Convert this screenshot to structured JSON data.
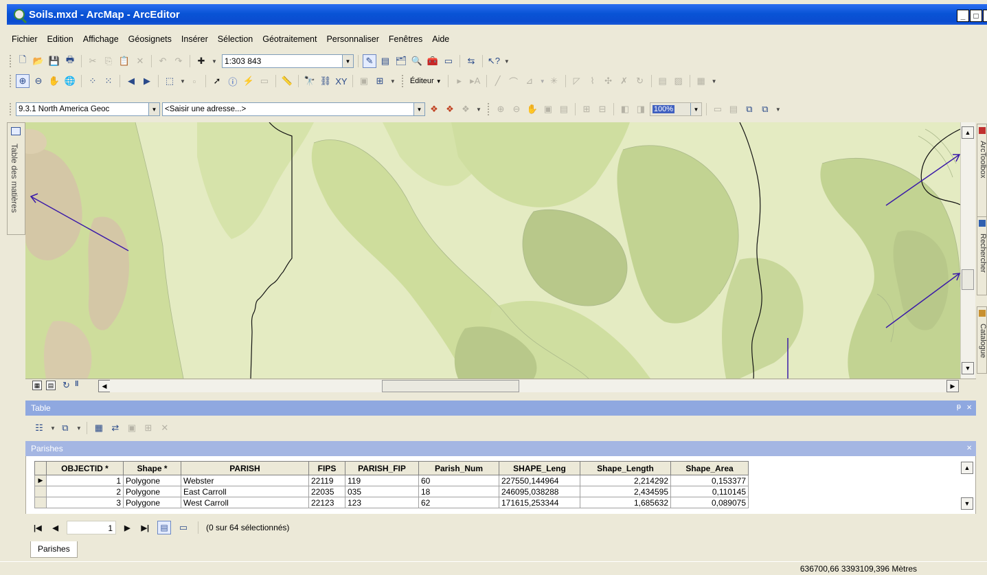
{
  "window": {
    "title": "Soils.mxd - ArcMap - ArcEditor",
    "min_label": "_",
    "max_label": "□",
    "close_label": "×"
  },
  "menu": [
    "Fichier",
    "Edition",
    "Affichage",
    "Géosignets",
    "Insérer",
    "Sélection",
    "Géotraitement",
    "Personnaliser",
    "Fenêtres",
    "Aide"
  ],
  "toolbar_standard": {
    "scale": "1:303 843"
  },
  "toolbar_tools": {
    "editor_label": "Éditeur"
  },
  "toolbar_geocode": {
    "locator": "9.3.1 North America Geoc",
    "address_placeholder": "<Saisir une adresse...>",
    "zoom_percent": "100%"
  },
  "dock_left": {
    "toc_label": "Table des matières"
  },
  "dock_right": {
    "tab_arctoolbox": "ArcToolbox",
    "tab_search": "Rechercher",
    "tab_catalog": "Catalogue"
  },
  "table_window": {
    "title": "Table",
    "layer_name": "Parishes"
  },
  "attribute_table": {
    "columns": [
      "OBJECTID *",
      "Shape *",
      "PARISH",
      "FIPS",
      "PARISH_FIP",
      "Parish_Num",
      "SHAPE_Leng",
      "Shape_Length",
      "Shape_Area"
    ],
    "rows": [
      [
        "1",
        "Polygone",
        "Webster",
        "22119",
        "119",
        "60",
        "227550,144964",
        "2,214292",
        "0,153377"
      ],
      [
        "2",
        "Polygone",
        "East Carroll",
        "22035",
        "035",
        "18",
        "246095,038288",
        "2,434595",
        "0,110145"
      ],
      [
        "3",
        "Polygone",
        "West Carroll",
        "22123",
        "123",
        "62",
        "171615,253344",
        "1,685632",
        "0,089075"
      ]
    ]
  },
  "navigation": {
    "record": "1",
    "selection_status": "(0 sur 64 sélectionnés)"
  },
  "layer_tab": "Parishes",
  "status": {
    "coordinates": "636700,66  3393109,396 Mètres"
  },
  "colors": {
    "title_bar": "#0a54d8",
    "map_light": "#e4ebc2",
    "map_mid": "#cedd9c",
    "map_dark": "#b8c88a",
    "map_tan": "#d4c7a6",
    "annotation_arrows": "#3a1aa8",
    "table_header": "#8fa8e0"
  }
}
